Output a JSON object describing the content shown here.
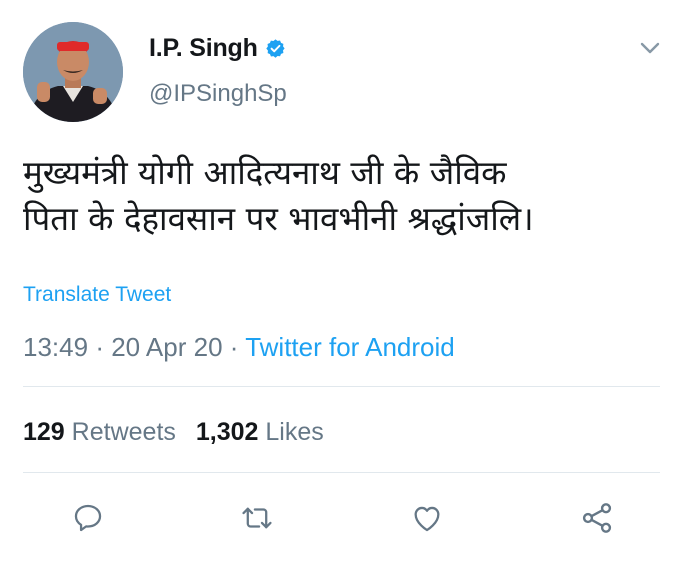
{
  "user": {
    "name": "I.P. Singh",
    "handle": "@IPSinghSp",
    "verified": true
  },
  "tweet": {
    "line1": "मुख्यमंत्री योगी आदित्यनाथ जी के जैविक",
    "line2": "पिता के देहावसान पर भावभीनी श्रद्धांजलि।",
    "translate_label": "Translate Tweet",
    "time": "13:49",
    "date": "20 Apr 20",
    "separator": "·",
    "source": "Twitter for Android"
  },
  "stats": {
    "retweets_count": "129",
    "retweets_label": "Retweets",
    "likes_count": "1,302",
    "likes_label": "Likes"
  },
  "colors": {
    "accent": "#1da1f2",
    "secondary_text": "#657786",
    "divider": "#e1e8ed"
  },
  "icons": [
    "chevron-down-icon",
    "verified-badge-icon",
    "reply-icon",
    "retweet-icon",
    "like-icon",
    "share-icon"
  ]
}
